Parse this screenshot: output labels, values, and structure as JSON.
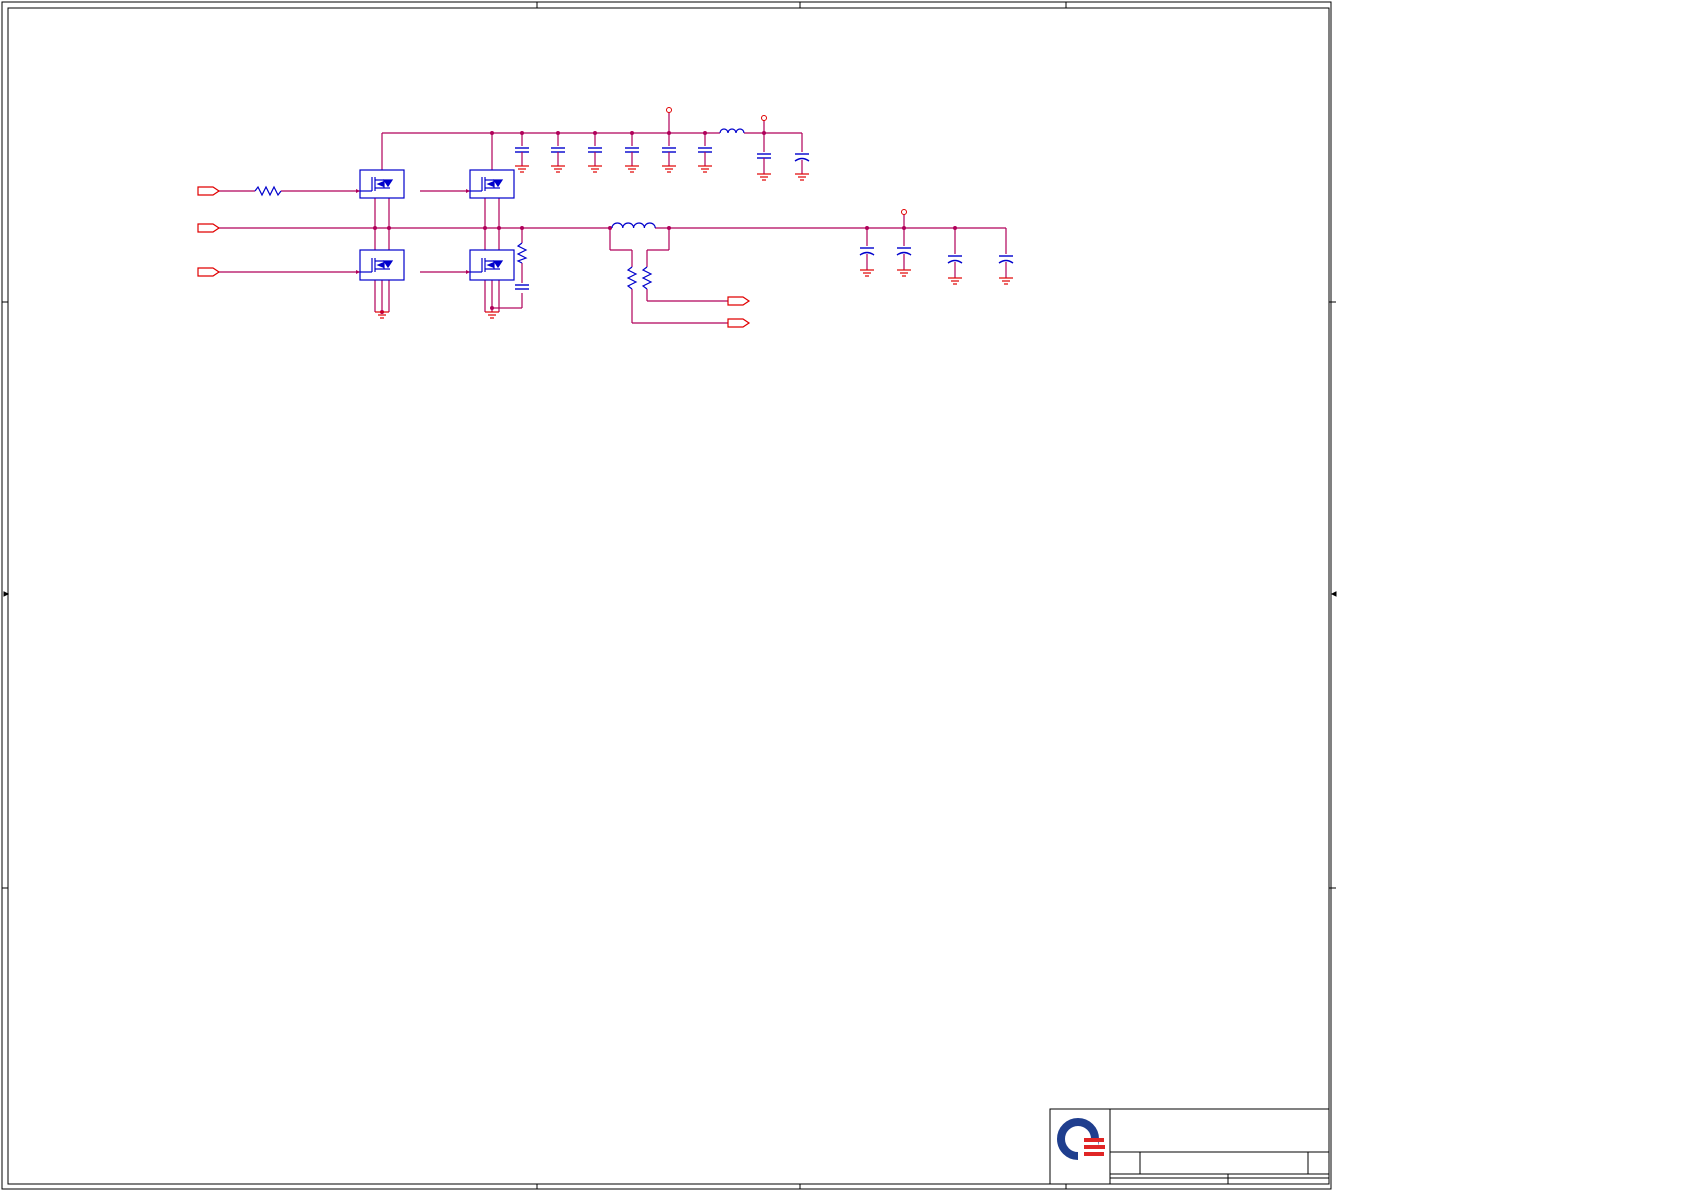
{
  "sheet": {
    "colors": {
      "wire": "#b0005a",
      "component": "#0000cc",
      "ground": "#e00000",
      "connector": "#e00000",
      "frame": "#000000",
      "logo_blue": "#1f3e8e",
      "logo_red": "#e02525"
    },
    "connectors": [
      {
        "id": "conn-gate-high"
      },
      {
        "id": "conn-phase"
      },
      {
        "id": "conn-gate-low"
      },
      {
        "id": "conn-sense-a"
      },
      {
        "id": "conn-sense-b"
      }
    ],
    "title_block": {
      "logo": "company-logo",
      "title": "",
      "document_number": "",
      "revision": "",
      "date": "",
      "sheet": ""
    }
  }
}
